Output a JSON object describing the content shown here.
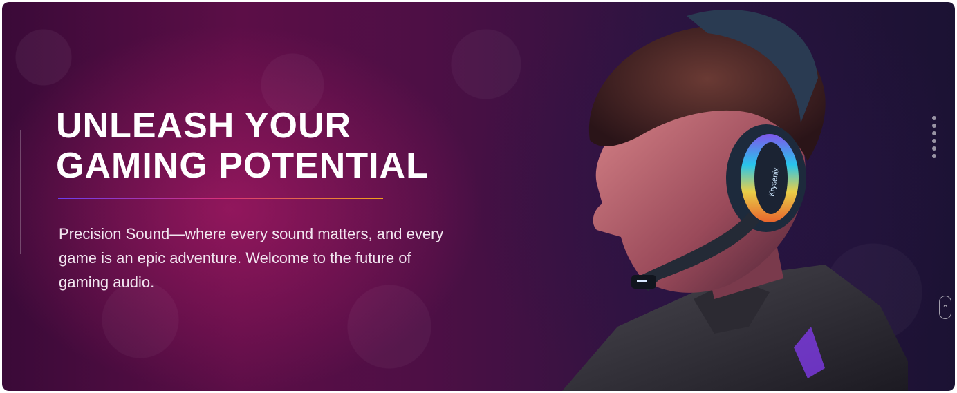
{
  "hero": {
    "headline_line1": "UNLEASH YOUR",
    "headline_line2": "GAMING POTENTIAL",
    "description": "Precision Sound—where every sound matters, and every game is an epic adventure. Welcome to the future of gaming audio.",
    "product_brand_on_headset": "Krysenix",
    "image": "gamer-wearing-rgb-headset"
  },
  "colors": {
    "background_start": "#3a0a38",
    "background_end": "#1b1233",
    "rule_gradient": [
      "#6a3df0",
      "#d8307a",
      "#f2a218"
    ],
    "text": "#ffffff"
  },
  "slider": {
    "dot_count": 6
  },
  "icons": {
    "scroll_top": "chevron-up-icon"
  }
}
